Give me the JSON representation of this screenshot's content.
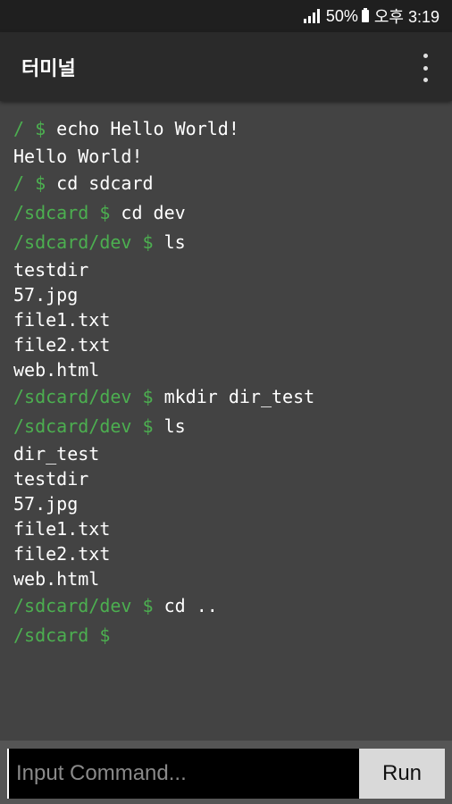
{
  "status_bar": {
    "battery_percent": "50%",
    "time": "오후 3:19"
  },
  "app_bar": {
    "title": "터미널",
    "menu_icon": "more-vert-icon"
  },
  "terminal": {
    "prompt_color": "#4caf50",
    "lines": [
      {
        "prompt": "/ $",
        "text": " echo Hello World!"
      },
      {
        "prompt": "",
        "text": "Hello World!"
      },
      {
        "prompt": "/ $",
        "text": " cd sdcard"
      },
      {
        "prompt": "/sdcard $",
        "text": " cd dev"
      },
      {
        "prompt": "/sdcard/dev $",
        "text": " ls"
      },
      {
        "prompt": "",
        "text": "testdir"
      },
      {
        "prompt": "",
        "text": "57.jpg"
      },
      {
        "prompt": "",
        "text": "file1.txt"
      },
      {
        "prompt": "",
        "text": "file2.txt"
      },
      {
        "prompt": "",
        "text": "web.html"
      },
      {
        "prompt": "/sdcard/dev $",
        "text": " mkdir dir_test"
      },
      {
        "prompt": "/sdcard/dev $",
        "text": " ls"
      },
      {
        "prompt": "",
        "text": "dir_test"
      },
      {
        "prompt": "",
        "text": "testdir"
      },
      {
        "prompt": "",
        "text": "57.jpg"
      },
      {
        "prompt": "",
        "text": "file1.txt"
      },
      {
        "prompt": "",
        "text": "file2.txt"
      },
      {
        "prompt": "",
        "text": "web.html"
      },
      {
        "prompt": "/sdcard/dev $",
        "text": " cd .."
      },
      {
        "prompt": "/sdcard $",
        "text": ""
      }
    ]
  },
  "input": {
    "placeholder": "Input Command...",
    "value": ""
  },
  "run_button": {
    "label": "Run"
  }
}
